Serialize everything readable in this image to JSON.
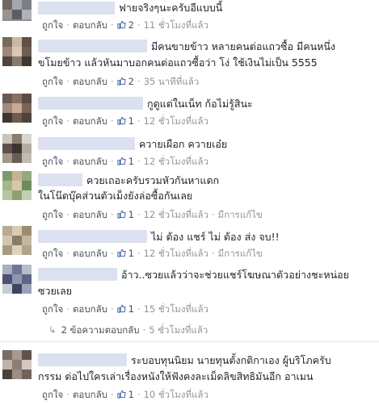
{
  "labels": {
    "like": "ถูกใจ",
    "reply": "ตอบกลับ",
    "edited": "มีการแก้ไข",
    "sep": "·"
  },
  "comments": [
    {
      "text_lines": [
        "ฟายจริงๆนะครับอีแบบนี้"
      ],
      "likes": "2",
      "time": "11 ชั่วโมงที่แล้ว",
      "edited": false
    },
    {
      "text_lines": [
        "มีคนขายข้าว หลายคนต่อแถวซื้อ มีคนหนึ่ง",
        "ขโมยข้าว แล้วหันมาบอกคนต่อแถวซื้อว่า โง่ ใช้เงินไม่เป็น 5555"
      ],
      "likes": "2",
      "time": "35 นาทีที่แล้ว",
      "edited": false
    },
    {
      "text_lines": [
        "กูดูแต่ในเน็ท ก้อไม่รู้สินะ"
      ],
      "likes": "1",
      "time": "12 ชั่วโมงที่แล้ว",
      "edited": false
    },
    {
      "text_lines": [
        "ควายเผือก ควายเอ๋ย"
      ],
      "likes": "1",
      "time": "12 ชั่วโมงที่แล้ว",
      "edited": false
    },
    {
      "text_lines": [
        "ควยเถอะครับรวมหัวกันหาแดก",
        "ในโน๊ตบุ๊คส่วนตัวเม็งยังล่อซื้อกันเลย"
      ],
      "likes": "1",
      "time": "12 ชั่วโมงที่แล้ว",
      "edited": true
    },
    {
      "text_lines": [
        "ไม่ ต้อง แชร์ ไม่ ต้อง ส่ง จบ!!"
      ],
      "likes": "1",
      "time": "12 ชั่วโมงที่แล้ว",
      "edited": true
    },
    {
      "text_lines": [
        "อ้าว..ซวยแล้วว่าจะช่วยแชร์โฆษณาตัวอย่างชะหน่อย",
        "ซวยเลย"
      ],
      "likes": "1",
      "time": "15 ชั่วโมงที่แล้ว",
      "edited": false
    },
    {
      "text_lines": [
        "ระบอบทุนนิยม นายทุนตั้งกติกาเอง ผู้บริโภครับ",
        "กรรม ต่อไปใครเล่าเรื่องหนังให้ฟังคงละเม็ดลิขสิทธิมันอีก อาเมน"
      ],
      "likes": "1",
      "time": "10 ชั่วโมงที่แล้ว",
      "edited": false
    }
  ],
  "replies_summary": {
    "arrow": "↳",
    "label": "2 ข้อความตอบกลับ",
    "time": "5 ชั่วโมงที่แล้ว"
  },
  "colors": {
    "link": "#4b4f56",
    "muted": "#90949c",
    "like_blue": "#4267b2",
    "name_blur": "#dbe1ee"
  }
}
